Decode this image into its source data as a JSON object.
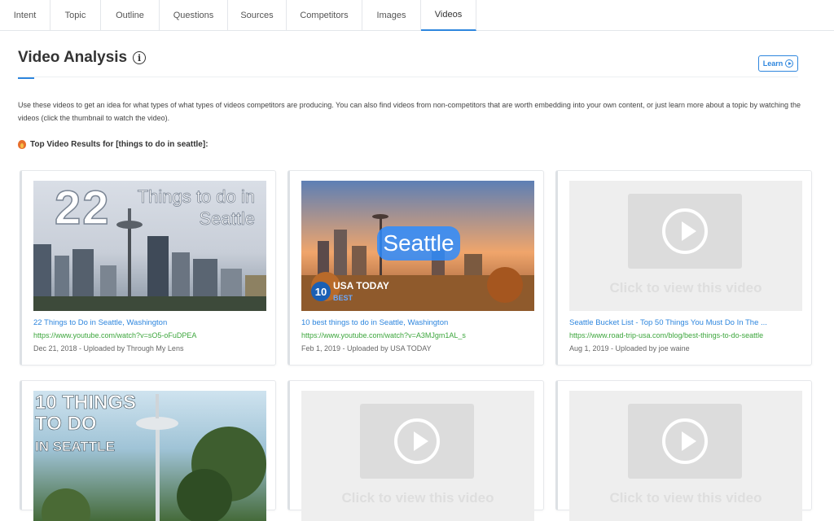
{
  "tabs": [
    {
      "label": "Intent",
      "w": 62
    },
    {
      "label": "Topic",
      "w": 62
    },
    {
      "label": "Outline",
      "w": 72
    },
    {
      "label": "Questions",
      "w": 84
    },
    {
      "label": "Sources",
      "w": 72
    },
    {
      "label": "Competitors",
      "w": 93
    },
    {
      "label": "Images",
      "w": 72
    },
    {
      "label": "Videos",
      "w": 68
    }
  ],
  "active_tab": "Videos",
  "page": {
    "title": "Video Analysis",
    "info_icon": "i",
    "learn_label": "Learn",
    "description": "Use these videos to get an idea for what types of what types of videos competitors are producing. You can also find videos from non-competitors that are worth embedding into your own content, or just learn more about a topic by watching the videos (click the thumbnail to watch the video).",
    "subheading": "Top Video Results for [things to do in seattle]:"
  },
  "colors": {
    "accent": "#2e86de",
    "url_green": "#3da63d"
  },
  "videos": [
    {
      "title": "22 Things to Do in Seattle, Washington",
      "url": "https://www.youtube.com/watch?v=sO5-oFuDPEA",
      "meta": "Dec 21, 2018 - Uploaded by Through My Lens",
      "thumb_big": "22",
      "thumb_small": "Things to do in Seattle"
    },
    {
      "title": "10 best things to do in Seattle, Washington",
      "url": "https://www.youtube.com/watch?v=A3MJgm1AL_s",
      "meta": "Feb 1, 2019 - Uploaded by USA TODAY",
      "thumb_city": "Seattle",
      "thumb_brand": "USA TODAY",
      "thumb_badge": "10",
      "thumb_sub": "BEST"
    },
    {
      "title": "Seattle Bucket List - Top 50 Things You Must Do In The ...",
      "url": "https://www.road-trip-usa.com/blog/best-things-to-do-seattle",
      "meta": "Aug 1, 2019 - Uploaded by joe waine",
      "placeholder": "Click to view this video"
    },
    {
      "thumb_line1": "10 THINGS",
      "thumb_line2": "TO DO",
      "thumb_line3": "IN SEATTLE"
    },
    {
      "placeholder": "Click to view this video"
    },
    {
      "placeholder": "Click to view this video"
    }
  ]
}
